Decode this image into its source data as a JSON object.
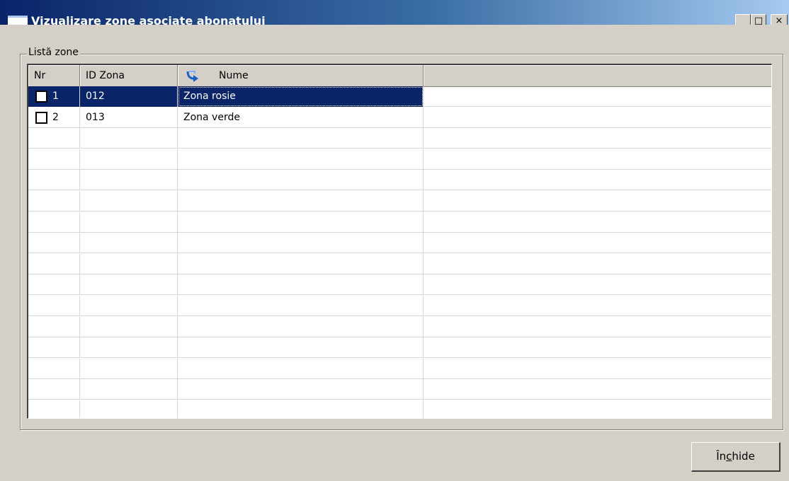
{
  "window": {
    "title": "Vizualizare zone asociate abonatului",
    "controls": {
      "minimize": "_",
      "maximize": "□",
      "close": "×"
    }
  },
  "group": {
    "label": "Listă zone"
  },
  "table": {
    "columns": [
      "Nr",
      "ID Zona",
      "Nume",
      ""
    ],
    "sort_icon": "sort-arrow-icon",
    "rows": [
      {
        "nr": "1",
        "id": "012",
        "nume": "Zona rosie",
        "selected": true,
        "checked": false
      },
      {
        "nr": "2",
        "id": "013",
        "nume": "Zona verde",
        "selected": false,
        "checked": false
      }
    ],
    "empty_rows": 15
  },
  "buttons": {
    "close_label_pre": "În",
    "close_label_accel": "c",
    "close_label_post": "hide"
  },
  "colors": {
    "titlebar_start": "#0a246a",
    "titlebar_end": "#a6caf0",
    "selection": "#0a246a",
    "face": "#d4d0c8"
  }
}
